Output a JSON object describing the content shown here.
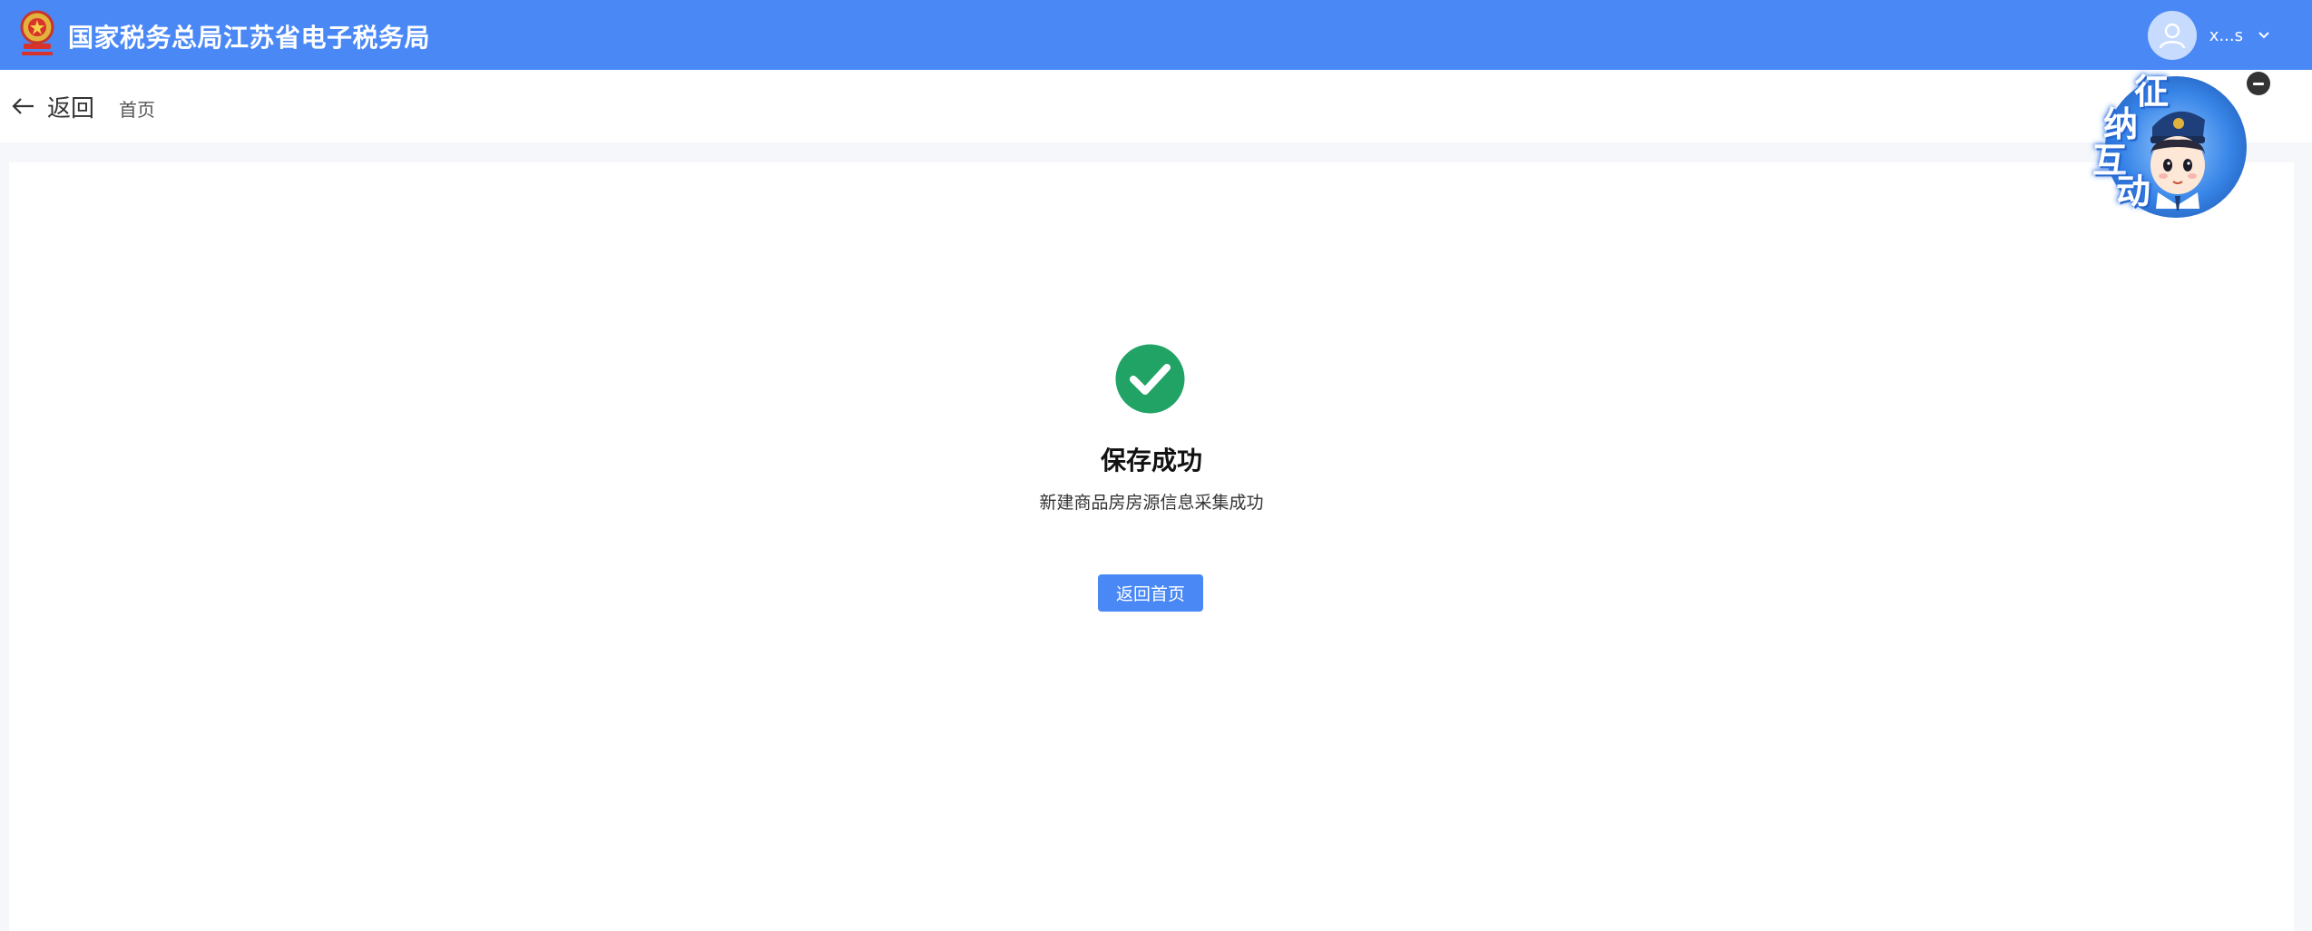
{
  "header": {
    "site_title": "国家税务总局江苏省电子税务局",
    "username": "x...s",
    "emblem_icon": "national-emblem-icon",
    "avatar_icon": "user-avatar-icon",
    "chevron_icon": "chevron-down-icon",
    "background_color": "#4a88f6"
  },
  "subheader": {
    "back_label": "返回",
    "back_icon": "arrow-left-icon",
    "breadcrumb_home": "首页"
  },
  "result": {
    "status": "success",
    "status_icon": "check-circle-icon",
    "status_color": "#21a366",
    "title": "保存成功",
    "description": "新建商品房房源信息采集成功",
    "home_button_label": "返回首页",
    "button_color": "#4a88f6"
  },
  "mascot": {
    "chars": [
      "征",
      "纳",
      "互",
      "动"
    ],
    "close_icon": "minus-circle-icon"
  }
}
